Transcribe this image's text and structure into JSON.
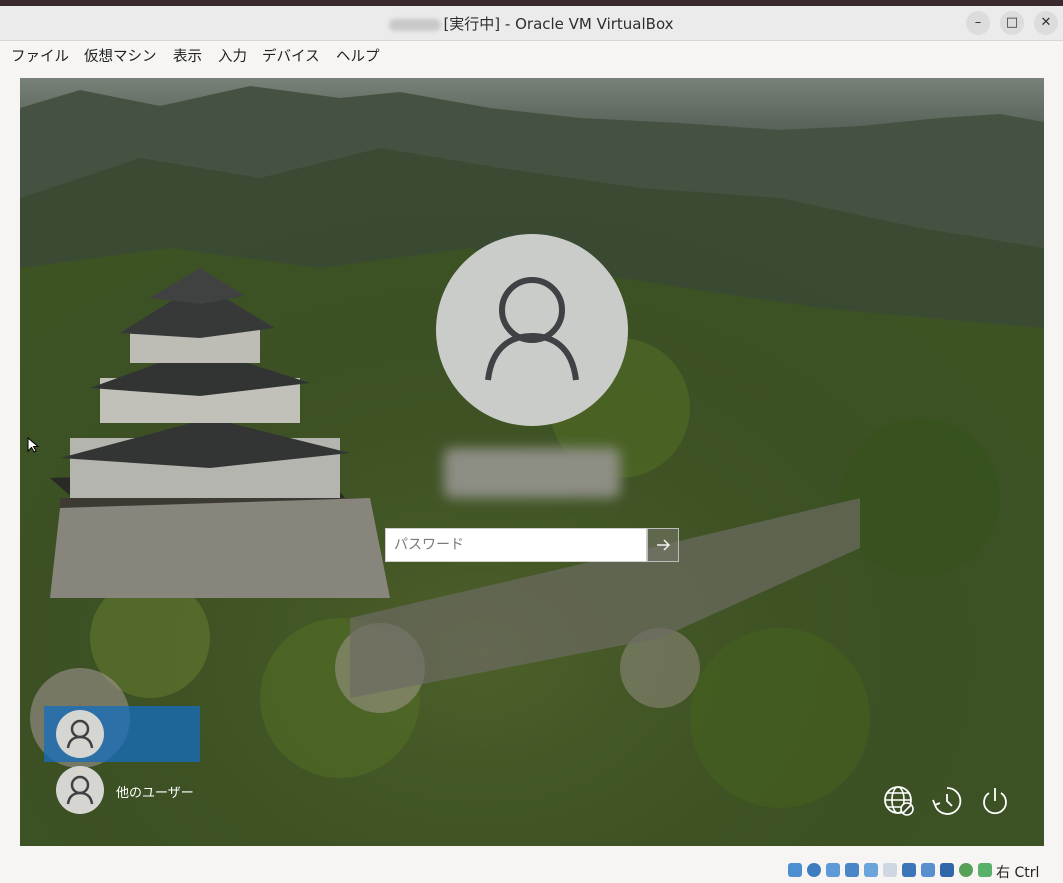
{
  "window": {
    "title": "[実行中] - Oracle VM VirtualBox",
    "minimize_label": "–",
    "maximize_label": "□",
    "close_label": "✕"
  },
  "menu": [
    "ファイル",
    "仮想マシン",
    "表示",
    "入力",
    "デバイス",
    "ヘルプ"
  ],
  "login": {
    "password_placeholder": "パスワード",
    "submit_icon": "arrow-right-icon",
    "users": [
      {
        "label": "",
        "selected": true
      },
      {
        "label": "他のユーザー",
        "selected": false
      }
    ],
    "bottom_icons": [
      "network-icon",
      "accessibility-icon",
      "power-icon"
    ]
  },
  "statusbar": {
    "host_key": "右 Ctrl",
    "icons": [
      "harddisk-icon",
      "optical-icon",
      "audio-icon",
      "network-icon",
      "usb-icon",
      "shared-folders-icon",
      "display-icon",
      "recording-icon",
      "cpu-icon",
      "vm-icon",
      "mouse-integration-icon"
    ]
  }
}
